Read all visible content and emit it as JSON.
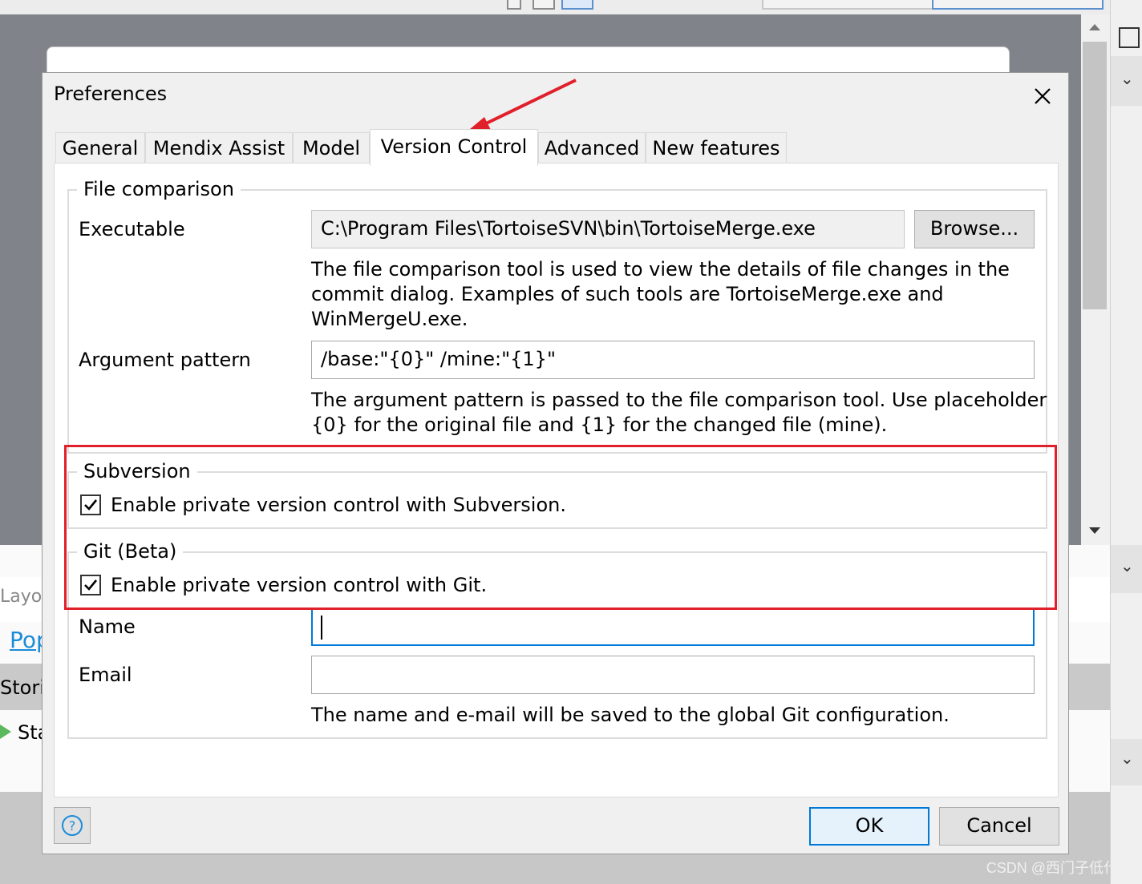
{
  "background": {
    "partial_labels": [
      "Layo",
      "Pop",
      "Storie",
      "Sta"
    ]
  },
  "dialog": {
    "title": "Preferences",
    "tabs": [
      "General",
      "Mendix Assist",
      "Model",
      "Version Control",
      "Advanced",
      "New features"
    ],
    "active_tab": "Version Control",
    "file_comparison": {
      "legend": "File comparison",
      "executable_label": "Executable",
      "executable_value": "C:\\Program Files\\TortoiseSVN\\bin\\TortoiseMerge.exe",
      "browse_label": "Browse...",
      "executable_help": [
        "The file comparison tool is used to view the details of file changes in the",
        "commit dialog. Examples of such tools are TortoiseMerge.exe and",
        "WinMergeU.exe."
      ],
      "argument_label": "Argument pattern",
      "argument_value": "/base:\"{0}\" /mine:\"{1}\"",
      "argument_help": [
        "The argument pattern is passed to the file comparison tool. Use placeholder",
        "{0} for the original file and {1} for the changed file (mine)."
      ]
    },
    "subversion": {
      "legend": "Subversion",
      "checkbox_label": "Enable private version control with Subversion.",
      "checked": true
    },
    "git": {
      "legend": "Git (Beta)",
      "checkbox_label": "Enable private version control with Git.",
      "checked": true,
      "name_label": "Name",
      "name_value": "",
      "email_label": "Email",
      "email_value": "",
      "help": "The name and e-mail will be saved to the global Git configuration."
    },
    "ok_label": "OK",
    "cancel_label": "Cancel"
  },
  "watermark": "CSDN @西门子低代码",
  "colors": {
    "annotation_red": "#e0202a",
    "focus_blue": "#0078d7",
    "link_blue": "#1a8cd8",
    "arrow_green": "#5cb85c"
  }
}
